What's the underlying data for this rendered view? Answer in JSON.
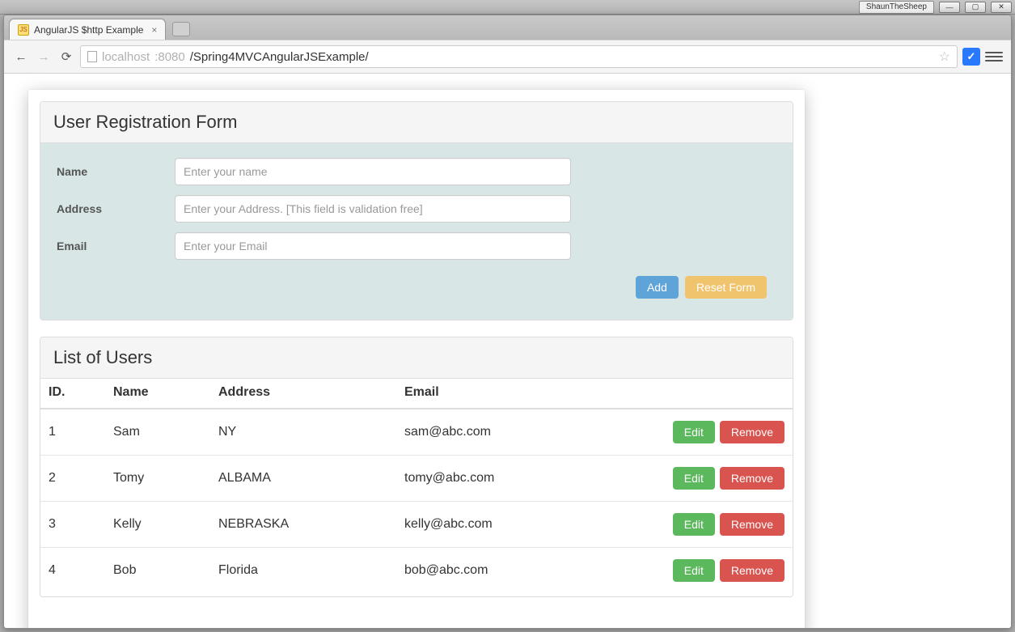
{
  "os": {
    "user_badge": "ShaunTheSheep"
  },
  "browser": {
    "tab_title": "AngularJS $http Example",
    "url_host": "localhost",
    "url_port": ":8080",
    "url_path": "/Spring4MVCAngularJSExample/"
  },
  "form": {
    "heading": "User Registration Form",
    "fields": {
      "name_label": "Name",
      "name_placeholder": "Enter your name",
      "address_label": "Address",
      "address_placeholder": "Enter your Address. [This field is validation free]",
      "email_label": "Email",
      "email_placeholder": "Enter your Email"
    },
    "add_button": "Add",
    "reset_button": "Reset Form"
  },
  "userlist": {
    "heading": "List of Users",
    "columns": {
      "id": "ID.",
      "name": "Name",
      "address": "Address",
      "email": "Email"
    },
    "edit_button": "Edit",
    "remove_button": "Remove",
    "rows": [
      {
        "id": "1",
        "name": "Sam",
        "address": "NY",
        "email": "sam@abc.com"
      },
      {
        "id": "2",
        "name": "Tomy",
        "address": "ALBAMA",
        "email": "tomy@abc.com"
      },
      {
        "id": "3",
        "name": "Kelly",
        "address": "NEBRASKA",
        "email": "kelly@abc.com"
      },
      {
        "id": "4",
        "name": "Bob",
        "address": "Florida",
        "email": "bob@abc.com"
      }
    ]
  }
}
